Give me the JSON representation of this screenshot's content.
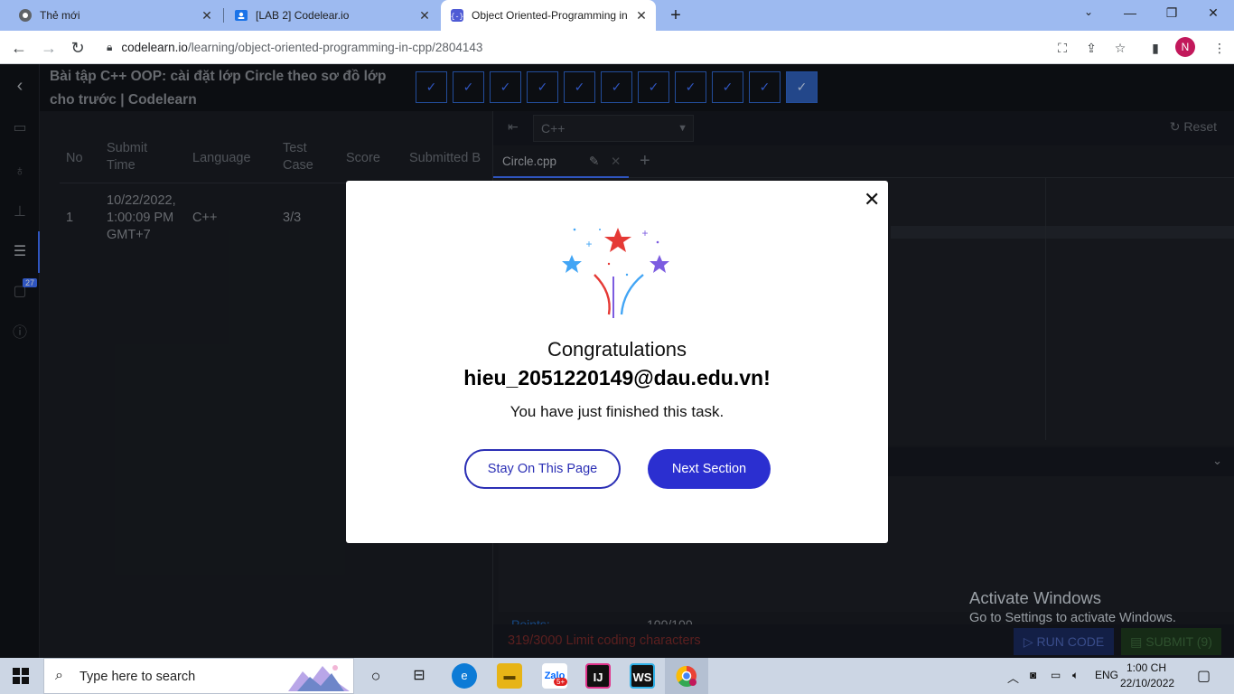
{
  "browser": {
    "tabs": [
      {
        "title": "Thẻ mới",
        "active": false
      },
      {
        "title": "[LAB 2] Codelear.io",
        "active": false
      },
      {
        "title": "Object Oriented-Programming in",
        "active": true
      }
    ],
    "url_host": "codelearn.io",
    "url_path": "/learning/object-oriented-programming-in-cpp/2804143",
    "profile_initial": "N"
  },
  "header": {
    "lesson_title": "Bài tập C++ OOP: cài đặt lớp Circle theo sơ đồ lớp cho trước | Codelearn",
    "steps_completed": 11
  },
  "sidebar": {
    "discussion_badge": "27"
  },
  "submissions": {
    "headers": {
      "no": "No",
      "submit_time_1": "Submit",
      "submit_time_2": "Time",
      "language": "Language",
      "test_case_1": "Test",
      "test_case_2": "Case",
      "score": "Score",
      "submitted_by": "Submitted B"
    },
    "row": {
      "no": "1",
      "time_1": "10/22/2022,",
      "time_2": "1:00:09 PM",
      "time_3": "GMT+7",
      "language": "C++",
      "test_case": "3/3"
    }
  },
  "editor": {
    "language": "C++",
    "reset_label": "Reset",
    "file_tab": "Circle.cpp",
    "points_label": "Points:",
    "points_value": "100/100",
    "limit_text": "319/3000 Limit coding characters",
    "run_label": "RUN CODE",
    "submit_label": "SUBMIT (9)"
  },
  "watermark": {
    "line1": "Activate Windows",
    "line2": "Go to Settings to activate Windows."
  },
  "modal": {
    "heading": "Congratulations",
    "email": "hieu_2051220149@dau.edu.vn!",
    "message": "You have just finished this task.",
    "stay_label": "Stay On This Page",
    "next_label": "Next Section"
  },
  "taskbar": {
    "search_placeholder": "Type here to search",
    "lang": "ENG",
    "time": "1:00 CH",
    "date": "22/10/2022",
    "zalo_badge": "5+"
  },
  "colors": {
    "accent": "#2b2fd0",
    "brand_blue": "#3f72ff"
  }
}
